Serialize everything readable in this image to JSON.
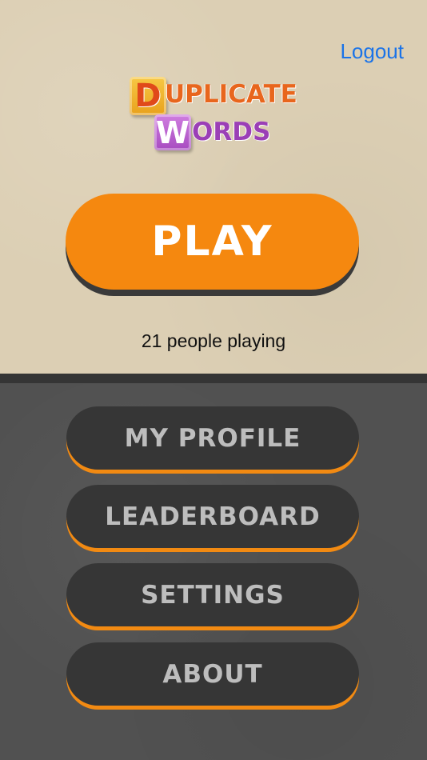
{
  "header": {
    "logout_label": "Logout"
  },
  "logo": {
    "first_letter": "D",
    "first_rest": "UPLICATE",
    "second_letter": "W",
    "second_rest": "ORDS"
  },
  "main": {
    "play_label": "PLAY",
    "players_text": "21 people playing"
  },
  "menu": {
    "items": [
      {
        "label": "MY PROFILE"
      },
      {
        "label": "LEADERBOARD"
      },
      {
        "label": "SETTINGS"
      },
      {
        "label": "ABOUT"
      }
    ]
  },
  "colors": {
    "accent": "#f5880f",
    "link": "#1a73e8",
    "top_bg": "#dccfb4",
    "bottom_bg": "#515151",
    "button_dark": "#363636"
  }
}
